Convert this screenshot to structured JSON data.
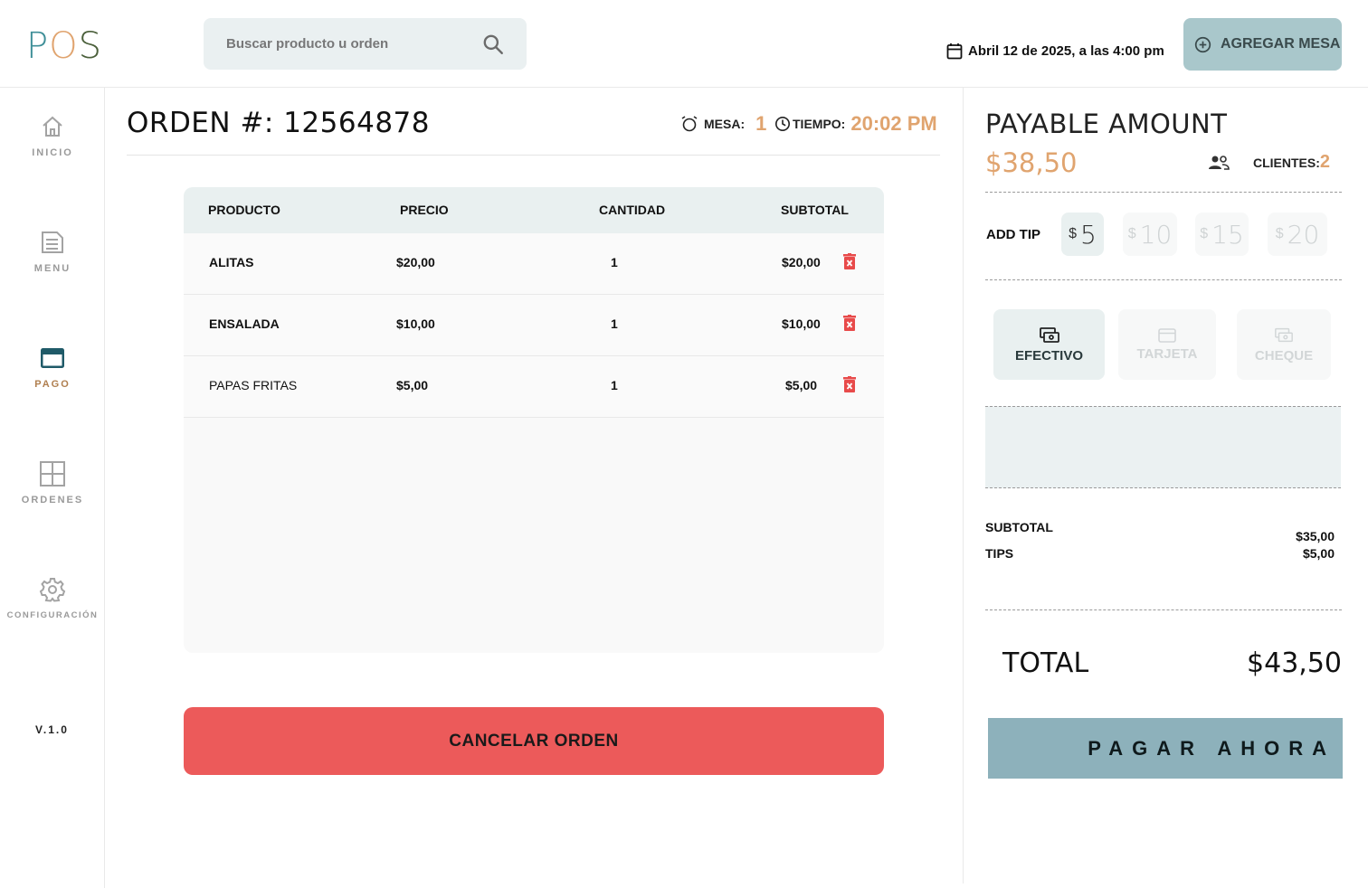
{
  "header": {
    "logo": {
      "p": "P",
      "o": "O",
      "s": "S"
    },
    "search_placeholder": "Buscar producto u orden",
    "date_text": "Abril 12 de 2025, a las 4:00 pm",
    "add_table_label": "AGREGAR MESA"
  },
  "sidebar": {
    "items": [
      {
        "label": "INICIO",
        "icon": "home-icon",
        "active": false
      },
      {
        "label": "MENU",
        "icon": "document-icon",
        "active": false
      },
      {
        "label": "PAGO",
        "icon": "credit-card-icon",
        "active": true
      },
      {
        "label": "ORDENES",
        "icon": "grid-icon",
        "active": false
      },
      {
        "label": "CONFIGURACIÓN",
        "icon": "gear-icon",
        "active": false
      }
    ],
    "version": "V.1.0"
  },
  "order": {
    "title": "ORDEN #: 12564878",
    "mesa_label": "MESA:",
    "mesa_value": "1",
    "tiempo_label": "TIEMPO:",
    "tiempo_value": "20:02 PM",
    "columns": [
      "PRODUCTO",
      "PRECIO",
      "CANTIDAD",
      "SUBTOTAL"
    ],
    "rows": [
      {
        "product": "ALITAS",
        "price": "$20,00",
        "qty": "1",
        "subtotal": "$20,00"
      },
      {
        "product": "ENSALADA",
        "price": "$10,00",
        "qty": "1",
        "subtotal": "$10,00"
      },
      {
        "product": "PAPAS FRITAS",
        "price": "$5,00",
        "qty": "1",
        "subtotal": "$5,00"
      }
    ],
    "cancel_label": "CANCELAR ORDEN"
  },
  "payment": {
    "title": "PAYABLE AMOUNT",
    "amount": "$38,50",
    "clients_label": "CLIENTES:",
    "clients_value": "2",
    "tip_label": "ADD TIP",
    "tips": [
      {
        "currency": "$",
        "value": "5",
        "active": true
      },
      {
        "currency": "$",
        "value": "10",
        "active": false
      },
      {
        "currency": "$",
        "value": "15",
        "active": false
      },
      {
        "currency": "$",
        "value": "20",
        "active": false
      }
    ],
    "methods": [
      {
        "label": "EFECTIVO",
        "icon": "cash-icon",
        "active": true
      },
      {
        "label": "TARJETA",
        "icon": "card-icon",
        "active": false
      },
      {
        "label": "CHEQUE",
        "icon": "cheque-icon",
        "active": false
      }
    ],
    "subtotal_label": "SUBTOTAL",
    "subtotal_value": "$35,00",
    "tips_label": "TIPS",
    "tips_value": "$5,00",
    "total_label": "TOTAL",
    "total_value": "$43,50",
    "pay_label": "PAGAR AHORA"
  },
  "colors": {
    "accent": "#e0a46f",
    "cancel": "#ec5a5a",
    "pay": "#8db1bb",
    "add_button": "#a9c7cb"
  }
}
